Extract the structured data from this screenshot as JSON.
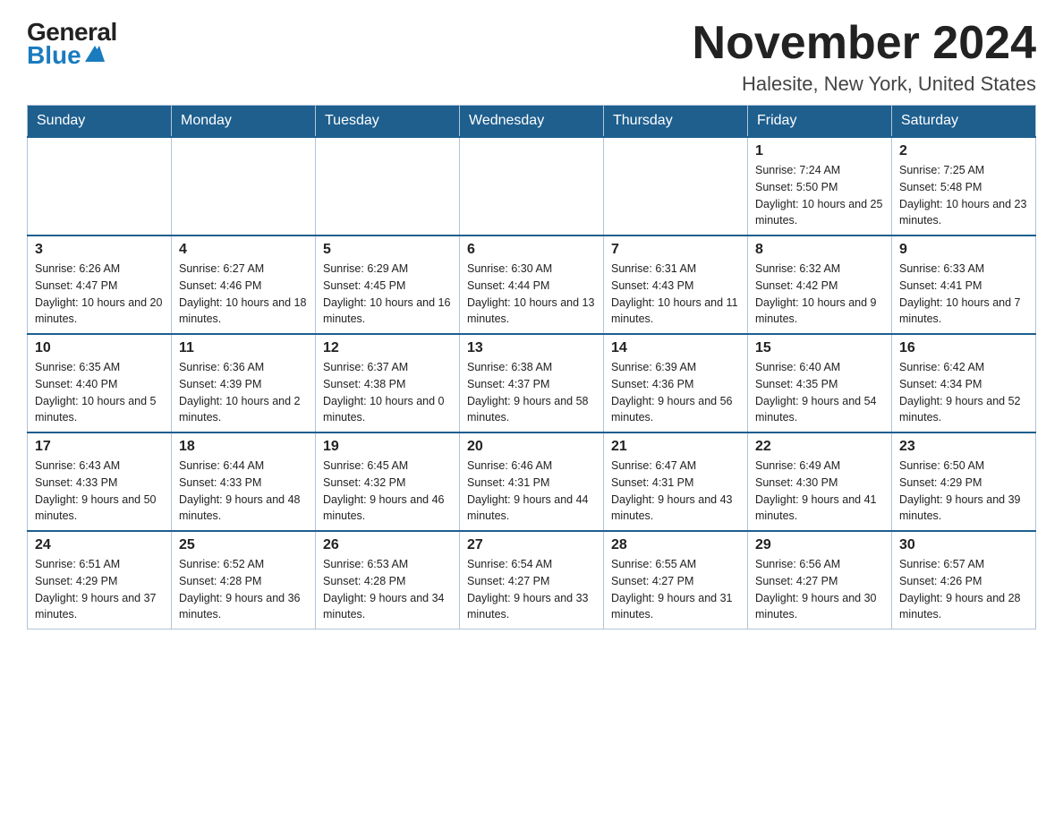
{
  "logo": {
    "general": "General",
    "blue": "Blue"
  },
  "title": "November 2024",
  "location": "Halesite, New York, United States",
  "days_of_week": [
    "Sunday",
    "Monday",
    "Tuesday",
    "Wednesday",
    "Thursday",
    "Friday",
    "Saturday"
  ],
  "weeks": [
    [
      {
        "day": "",
        "info": ""
      },
      {
        "day": "",
        "info": ""
      },
      {
        "day": "",
        "info": ""
      },
      {
        "day": "",
        "info": ""
      },
      {
        "day": "",
        "info": ""
      },
      {
        "day": "1",
        "info": "Sunrise: 7:24 AM\nSunset: 5:50 PM\nDaylight: 10 hours and 25 minutes."
      },
      {
        "day": "2",
        "info": "Sunrise: 7:25 AM\nSunset: 5:48 PM\nDaylight: 10 hours and 23 minutes."
      }
    ],
    [
      {
        "day": "3",
        "info": "Sunrise: 6:26 AM\nSunset: 4:47 PM\nDaylight: 10 hours and 20 minutes."
      },
      {
        "day": "4",
        "info": "Sunrise: 6:27 AM\nSunset: 4:46 PM\nDaylight: 10 hours and 18 minutes."
      },
      {
        "day": "5",
        "info": "Sunrise: 6:29 AM\nSunset: 4:45 PM\nDaylight: 10 hours and 16 minutes."
      },
      {
        "day": "6",
        "info": "Sunrise: 6:30 AM\nSunset: 4:44 PM\nDaylight: 10 hours and 13 minutes."
      },
      {
        "day": "7",
        "info": "Sunrise: 6:31 AM\nSunset: 4:43 PM\nDaylight: 10 hours and 11 minutes."
      },
      {
        "day": "8",
        "info": "Sunrise: 6:32 AM\nSunset: 4:42 PM\nDaylight: 10 hours and 9 minutes."
      },
      {
        "day": "9",
        "info": "Sunrise: 6:33 AM\nSunset: 4:41 PM\nDaylight: 10 hours and 7 minutes."
      }
    ],
    [
      {
        "day": "10",
        "info": "Sunrise: 6:35 AM\nSunset: 4:40 PM\nDaylight: 10 hours and 5 minutes."
      },
      {
        "day": "11",
        "info": "Sunrise: 6:36 AM\nSunset: 4:39 PM\nDaylight: 10 hours and 2 minutes."
      },
      {
        "day": "12",
        "info": "Sunrise: 6:37 AM\nSunset: 4:38 PM\nDaylight: 10 hours and 0 minutes."
      },
      {
        "day": "13",
        "info": "Sunrise: 6:38 AM\nSunset: 4:37 PM\nDaylight: 9 hours and 58 minutes."
      },
      {
        "day": "14",
        "info": "Sunrise: 6:39 AM\nSunset: 4:36 PM\nDaylight: 9 hours and 56 minutes."
      },
      {
        "day": "15",
        "info": "Sunrise: 6:40 AM\nSunset: 4:35 PM\nDaylight: 9 hours and 54 minutes."
      },
      {
        "day": "16",
        "info": "Sunrise: 6:42 AM\nSunset: 4:34 PM\nDaylight: 9 hours and 52 minutes."
      }
    ],
    [
      {
        "day": "17",
        "info": "Sunrise: 6:43 AM\nSunset: 4:33 PM\nDaylight: 9 hours and 50 minutes."
      },
      {
        "day": "18",
        "info": "Sunrise: 6:44 AM\nSunset: 4:33 PM\nDaylight: 9 hours and 48 minutes."
      },
      {
        "day": "19",
        "info": "Sunrise: 6:45 AM\nSunset: 4:32 PM\nDaylight: 9 hours and 46 minutes."
      },
      {
        "day": "20",
        "info": "Sunrise: 6:46 AM\nSunset: 4:31 PM\nDaylight: 9 hours and 44 minutes."
      },
      {
        "day": "21",
        "info": "Sunrise: 6:47 AM\nSunset: 4:31 PM\nDaylight: 9 hours and 43 minutes."
      },
      {
        "day": "22",
        "info": "Sunrise: 6:49 AM\nSunset: 4:30 PM\nDaylight: 9 hours and 41 minutes."
      },
      {
        "day": "23",
        "info": "Sunrise: 6:50 AM\nSunset: 4:29 PM\nDaylight: 9 hours and 39 minutes."
      }
    ],
    [
      {
        "day": "24",
        "info": "Sunrise: 6:51 AM\nSunset: 4:29 PM\nDaylight: 9 hours and 37 minutes."
      },
      {
        "day": "25",
        "info": "Sunrise: 6:52 AM\nSunset: 4:28 PM\nDaylight: 9 hours and 36 minutes."
      },
      {
        "day": "26",
        "info": "Sunrise: 6:53 AM\nSunset: 4:28 PM\nDaylight: 9 hours and 34 minutes."
      },
      {
        "day": "27",
        "info": "Sunrise: 6:54 AM\nSunset: 4:27 PM\nDaylight: 9 hours and 33 minutes."
      },
      {
        "day": "28",
        "info": "Sunrise: 6:55 AM\nSunset: 4:27 PM\nDaylight: 9 hours and 31 minutes."
      },
      {
        "day": "29",
        "info": "Sunrise: 6:56 AM\nSunset: 4:27 PM\nDaylight: 9 hours and 30 minutes."
      },
      {
        "day": "30",
        "info": "Sunrise: 6:57 AM\nSunset: 4:26 PM\nDaylight: 9 hours and 28 minutes."
      }
    ]
  ]
}
